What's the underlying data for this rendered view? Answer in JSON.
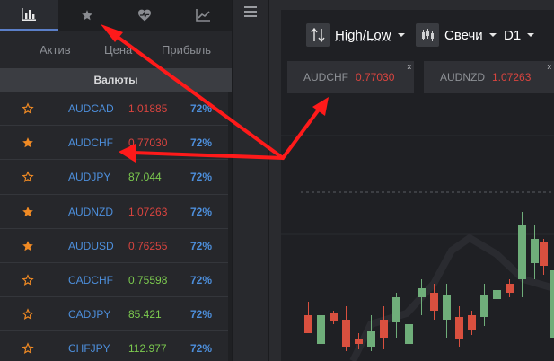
{
  "tabs": [
    {
      "icon": "bar-chart-icon",
      "active": true
    },
    {
      "icon": "star-icon",
      "active": false
    },
    {
      "icon": "heart-pulse-icon",
      "active": false
    },
    {
      "icon": "line-chart-icon",
      "active": false
    }
  ],
  "columns": {
    "asset": "Актив",
    "price": "Цена",
    "profit": "Прибыль"
  },
  "group_label": "Валюты",
  "assets": [
    {
      "symbol": "AUDCAD",
      "price": "1.01885",
      "trend": "down",
      "profit": "72%",
      "favorite": false
    },
    {
      "symbol": "AUDCHF",
      "price": "0.77030",
      "trend": "down",
      "profit": "72%",
      "favorite": true
    },
    {
      "symbol": "AUDJPY",
      "price": "87.044",
      "trend": "up",
      "profit": "72%",
      "favorite": false
    },
    {
      "symbol": "AUDNZD",
      "price": "1.07263",
      "trend": "down",
      "profit": "72%",
      "favorite": true
    },
    {
      "symbol": "AUDUSD",
      "price": "0.76255",
      "trend": "down",
      "profit": "72%",
      "favorite": true
    },
    {
      "symbol": "CADCHF",
      "price": "0.75598",
      "trend": "up",
      "profit": "72%",
      "favorite": false
    },
    {
      "symbol": "CADJPY",
      "price": "85.421",
      "trend": "up",
      "profit": "72%",
      "favorite": false
    },
    {
      "symbol": "CHFJPY",
      "price": "112.977",
      "trend": "up",
      "profit": "72%",
      "favorite": false
    }
  ],
  "toolbar": {
    "mode": "High/Low",
    "chart_type": "Свечи",
    "timeframe": "D1"
  },
  "open_charts": [
    {
      "symbol": "AUDCHF",
      "price": "0.77030",
      "close": "x"
    },
    {
      "symbol": "AUDNZD",
      "price": "1.07263",
      "close": "x"
    }
  ],
  "colors": {
    "accent": "#4d8fdc",
    "down": "#d9443f",
    "up": "#7ccb4f",
    "favorite_star": "#f08a24",
    "annotation_arrow": "#ff1a1a",
    "candle_up": "#6fae7a",
    "candle_down": "#d9503f"
  }
}
